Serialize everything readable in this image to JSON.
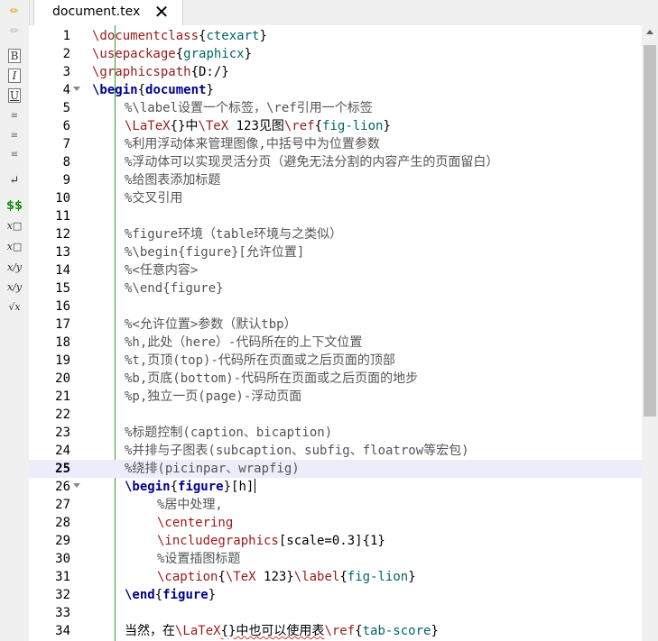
{
  "tab": {
    "label": "document.tex",
    "close": "✕"
  },
  "toolbar": [
    {
      "glyph": "B",
      "name": "bold-button"
    },
    {
      "glyph": "I",
      "name": "italic-button"
    },
    {
      "glyph": "U",
      "name": "underline-button"
    },
    {
      "glyph": "≡",
      "name": "align-left-button"
    },
    {
      "glyph": "≡",
      "name": "align-center-button"
    },
    {
      "glyph": "≡",
      "name": "align-right-button"
    },
    {
      "glyph": "↵",
      "name": "newline-button"
    },
    {
      "glyph": "$$",
      "name": "math-mode-button"
    },
    {
      "glyph": "x□",
      "name": "subscript-button"
    },
    {
      "glyph": "x□",
      "name": "superscript-button"
    },
    {
      "glyph": "x/y",
      "name": "fraction-button"
    },
    {
      "glyph": "x/y",
      "name": "display-fraction-button"
    },
    {
      "glyph": "√x",
      "name": "sqrt-button"
    }
  ],
  "editor": {
    "current_line": 25,
    "lines": [
      {
        "n": "1",
        "fold": false,
        "indent": 0,
        "tokens": [
          [
            "cmd",
            "\\documentclass"
          ],
          [
            "txt",
            "{"
          ],
          [
            "arg",
            "ctexart"
          ],
          [
            "txt",
            "}"
          ]
        ]
      },
      {
        "n": "2",
        "fold": false,
        "indent": 0,
        "tokens": [
          [
            "cmd",
            "\\usepackage"
          ],
          [
            "txt",
            "{"
          ],
          [
            "arg",
            "graphicx"
          ],
          [
            "txt",
            "}"
          ]
        ]
      },
      {
        "n": "3",
        "fold": false,
        "indent": 0,
        "tokens": [
          [
            "cmd",
            "\\graphicspath"
          ],
          [
            "txt",
            "{D:/}"
          ]
        ]
      },
      {
        "n": "4",
        "fold": true,
        "indent": 0,
        "tokens": [
          [
            "kw",
            "\\begin"
          ],
          [
            "txt",
            "{"
          ],
          [
            "kw",
            "document"
          ],
          [
            "txt",
            "}"
          ]
        ]
      },
      {
        "n": "5",
        "fold": false,
        "indent": 1,
        "tokens": [
          [
            "cm",
            "%\\label设置一个标签，\\ref引用一个标签"
          ]
        ]
      },
      {
        "n": "6",
        "fold": false,
        "indent": 1,
        "tokens": [
          [
            "cmd",
            "\\LaTeX"
          ],
          [
            "txt",
            "{}中"
          ],
          [
            "cmd",
            "\\TeX"
          ],
          [
            "txt",
            " 123见图"
          ],
          [
            "cmd",
            "\\ref"
          ],
          [
            "txt",
            "{"
          ],
          [
            "arg",
            "fig-lion"
          ],
          [
            "txt",
            "}"
          ]
        ]
      },
      {
        "n": "7",
        "fold": false,
        "indent": 1,
        "tokens": [
          [
            "cm",
            "%利用浮动体来管理图像,中括号中为位置参数"
          ]
        ]
      },
      {
        "n": "8",
        "fold": false,
        "indent": 1,
        "tokens": [
          [
            "cm",
            "%浮动体可以实现灵活分页（避免无法分割的内容产生的页面留白）"
          ]
        ]
      },
      {
        "n": "9",
        "fold": false,
        "indent": 1,
        "tokens": [
          [
            "cm",
            "%给图表添加标题"
          ]
        ]
      },
      {
        "n": "10",
        "fold": false,
        "indent": 1,
        "tokens": [
          [
            "cm",
            "%交叉引用"
          ]
        ]
      },
      {
        "n": "11",
        "fold": false,
        "indent": 0,
        "tokens": []
      },
      {
        "n": "12",
        "fold": false,
        "indent": 1,
        "tokens": [
          [
            "cm",
            "%figure环境（table环境与之类似）"
          ]
        ]
      },
      {
        "n": "13",
        "fold": false,
        "indent": 1,
        "tokens": [
          [
            "cm",
            "%\\begin{figure}[允许位置]"
          ]
        ]
      },
      {
        "n": "14",
        "fold": false,
        "indent": 1,
        "tokens": [
          [
            "cm",
            "%<任意内容>"
          ]
        ]
      },
      {
        "n": "15",
        "fold": false,
        "indent": 1,
        "tokens": [
          [
            "cm",
            "%\\end{figure}"
          ]
        ]
      },
      {
        "n": "16",
        "fold": false,
        "indent": 0,
        "tokens": []
      },
      {
        "n": "17",
        "fold": false,
        "indent": 1,
        "tokens": [
          [
            "cm",
            "%<允许位置>参数（默认tbp）"
          ]
        ]
      },
      {
        "n": "18",
        "fold": false,
        "indent": 1,
        "tokens": [
          [
            "cm",
            "%h,此处（here）-代码所在的上下文位置"
          ]
        ]
      },
      {
        "n": "19",
        "fold": false,
        "indent": 1,
        "tokens": [
          [
            "cm",
            "%t,页顶(top)-代码所在页面或之后页面的顶部"
          ]
        ]
      },
      {
        "n": "20",
        "fold": false,
        "indent": 1,
        "tokens": [
          [
            "cm",
            "%b,页底(bottom)-代码所在页面或之后页面的地步"
          ]
        ]
      },
      {
        "n": "21",
        "fold": false,
        "indent": 1,
        "tokens": [
          [
            "cm",
            "%p,独立一页(page)-浮动页面"
          ]
        ]
      },
      {
        "n": "22",
        "fold": false,
        "indent": 0,
        "tokens": []
      },
      {
        "n": "23",
        "fold": false,
        "indent": 1,
        "tokens": [
          [
            "cm",
            "%标题控制(caption、bicaption)"
          ]
        ]
      },
      {
        "n": "24",
        "fold": false,
        "indent": 1,
        "tokens": [
          [
            "cm",
            "%并排与子图表(subcaption、subfig、floatrow等宏包)"
          ]
        ]
      },
      {
        "n": "25",
        "fold": false,
        "indent": 1,
        "tokens": [
          [
            "cm",
            "%绕排(picinpar、wrapfig)"
          ]
        ]
      },
      {
        "n": "26",
        "fold": true,
        "indent": 1,
        "tokens": [
          [
            "kw",
            "\\begin"
          ],
          [
            "txt",
            "{"
          ],
          [
            "kw",
            "figure"
          ],
          [
            "txt",
            "}[h]"
          ]
        ],
        "caret": true
      },
      {
        "n": "27",
        "fold": false,
        "indent": 2,
        "tokens": [
          [
            "cm",
            "%居中处理,"
          ]
        ]
      },
      {
        "n": "28",
        "fold": false,
        "indent": 2,
        "tokens": [
          [
            "cmd",
            "\\centering"
          ]
        ]
      },
      {
        "n": "29",
        "fold": false,
        "indent": 2,
        "tokens": [
          [
            "cmd",
            "\\includegraphics"
          ],
          [
            "txt",
            "[scale=0.3]{1}"
          ]
        ]
      },
      {
        "n": "30",
        "fold": false,
        "indent": 2,
        "tokens": [
          [
            "cm",
            "%设置插图标题"
          ]
        ]
      },
      {
        "n": "31",
        "fold": false,
        "indent": 2,
        "tokens": [
          [
            "cmd",
            "\\caption"
          ],
          [
            "txt",
            "{"
          ],
          [
            "cmd",
            "\\TeX"
          ],
          [
            "txt",
            " 123}"
          ],
          [
            "cmd",
            "\\label"
          ],
          [
            "txt",
            "{"
          ],
          [
            "arg",
            "fig-lion"
          ],
          [
            "txt",
            "}"
          ]
        ]
      },
      {
        "n": "32",
        "fold": false,
        "indent": 1,
        "tokens": [
          [
            "kw",
            "\\end"
          ],
          [
            "txt",
            "{"
          ],
          [
            "kw",
            "figure"
          ],
          [
            "txt",
            "}"
          ]
        ]
      },
      {
        "n": "33",
        "fold": false,
        "indent": 0,
        "tokens": []
      },
      {
        "n": "34",
        "fold": false,
        "indent": 1,
        "tokens": [
          [
            "txt",
            "当然，在"
          ],
          [
            "cmd",
            "\\LaTeX"
          ],
          [
            "sq",
            "{}中也可以使用表"
          ],
          [
            "cmd",
            "\\ref"
          ],
          [
            "txt",
            "{"
          ],
          [
            "arg",
            "tab-score"
          ],
          [
            "txt",
            "}"
          ]
        ]
      }
    ]
  }
}
